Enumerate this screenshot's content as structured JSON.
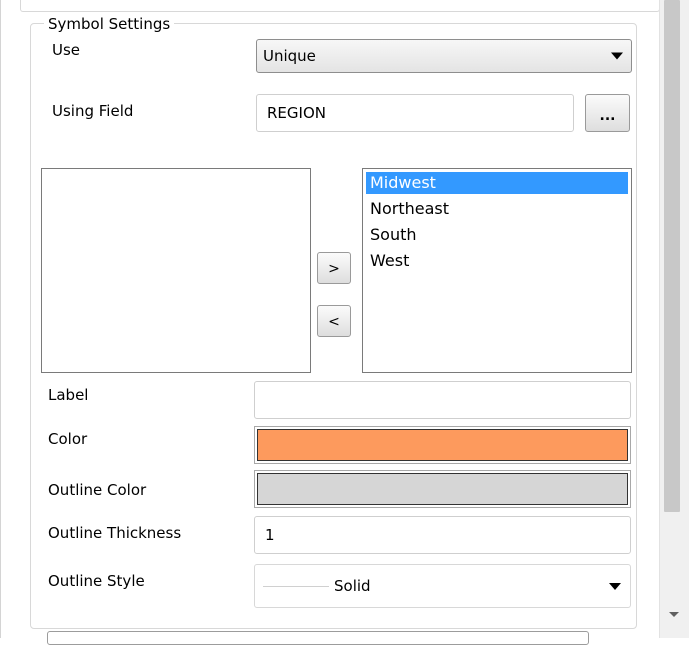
{
  "symbol_settings": {
    "title": "Symbol Settings",
    "use": {
      "label": "Use",
      "value": "Unique"
    },
    "using_field": {
      "label": "Using Field",
      "value": "REGION",
      "browse_label": "..."
    },
    "available_list": [],
    "move_right_label": ">",
    "move_left_label": "<",
    "selected_list": [
      {
        "label": "Midwest",
        "selected": true
      },
      {
        "label": "Northeast",
        "selected": false
      },
      {
        "label": "South",
        "selected": false
      },
      {
        "label": "West",
        "selected": false
      }
    ],
    "label_field": {
      "label": "Label",
      "value": ""
    },
    "color": {
      "label": "Color",
      "value": "#fd9a5d"
    },
    "outline_color": {
      "label": "Outline Color",
      "value": "#d6d6d6"
    },
    "outline_thickness": {
      "label": "Outline Thickness",
      "value": "1"
    },
    "outline_style": {
      "label": "Outline Style",
      "value": "Solid"
    }
  }
}
